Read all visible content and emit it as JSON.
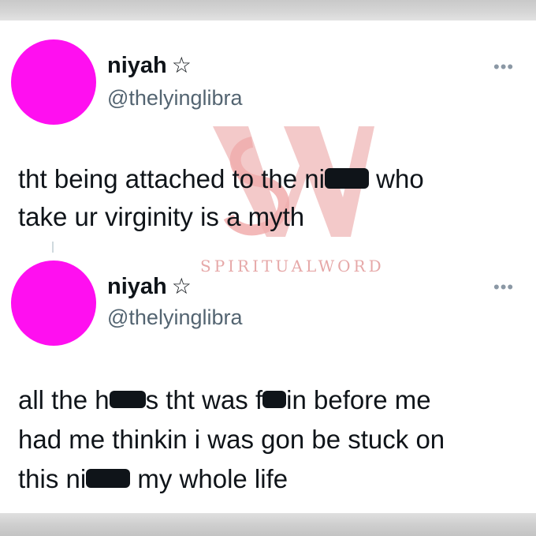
{
  "tweets": [
    {
      "name": "niyah",
      "name_badge": "☆",
      "handle": "@thelyinglibra",
      "lines": [
        {
          "parts": [
            "tht being attached to the ni",
            "",
            " who"
          ]
        },
        {
          "parts": [
            "take ur virginity is a myth"
          ]
        }
      ],
      "more": "•••"
    },
    {
      "name": "niyah",
      "name_badge": "☆",
      "handle": "@thelyinglibra",
      "lines": [
        {
          "parts": [
            "all the h",
            "",
            "s tht was f",
            "",
            "in before me"
          ]
        },
        {
          "parts": [
            "had me thinkin i was gon be stuck on"
          ]
        },
        {
          "parts": [
            "this ni",
            "",
            " my whole life"
          ]
        }
      ],
      "more": "•••"
    }
  ],
  "watermark": {
    "text": "SPIRITUALWORD",
    "logo": "SW",
    "color": "#e8a5a5"
  },
  "colors": {
    "avatar": "#ff0ff0",
    "handle": "#536471",
    "text": "#0f1419"
  }
}
